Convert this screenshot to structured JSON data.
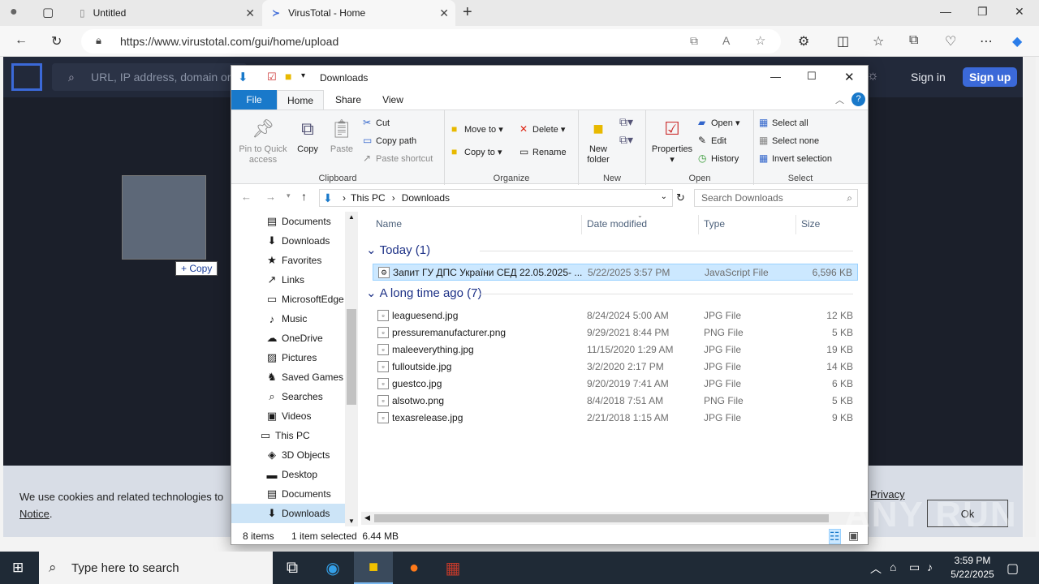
{
  "browser": {
    "tabs": [
      {
        "title": "Untitled",
        "active": false
      },
      {
        "title": "VirusTotal - Home",
        "active": true
      }
    ],
    "url": "https://www.virustotal.com/gui/home/upload"
  },
  "virustotal": {
    "search_placeholder": "URL, IP address, domain or fi",
    "signin": "Sign in",
    "signup": "Sign up",
    "drag_tooltip": "+ Copy",
    "cookie_text_1": "We use cookies and related technologies to",
    "cookie_text_2": "Notice",
    "privacy_link": "Privacy",
    "ok_button": "Ok"
  },
  "explorer": {
    "title": "Downloads",
    "ribbon_tabs": [
      "File",
      "Home",
      "Share",
      "View"
    ],
    "clipboard": {
      "label": "Clipboard",
      "pin": "Pin to Quick access",
      "copy": "Copy",
      "paste": "Paste",
      "cut": "Cut",
      "copy_path": "Copy path",
      "paste_shortcut": "Paste shortcut"
    },
    "organize": {
      "label": "Organize",
      "move_to": "Move to",
      "copy_to": "Copy to",
      "delete": "Delete",
      "rename": "Rename"
    },
    "new": {
      "label": "New",
      "new_folder": "New folder"
    },
    "open": {
      "label": "Open",
      "properties": "Properties",
      "open": "Open",
      "edit": "Edit",
      "history": "History"
    },
    "select": {
      "label": "Select",
      "select_all": "Select all",
      "select_none": "Select none",
      "invert": "Invert selection"
    },
    "breadcrumb": [
      "This PC",
      "Downloads"
    ],
    "search_placeholder": "Search Downloads",
    "nav_items": [
      {
        "label": "Documents",
        "icon": "documents-icon",
        "glyph": "▤"
      },
      {
        "label": "Downloads",
        "icon": "downloads-icon",
        "glyph": "⬇"
      },
      {
        "label": "Favorites",
        "icon": "favorites-icon",
        "glyph": "★"
      },
      {
        "label": "Links",
        "icon": "links-icon",
        "glyph": "↗"
      },
      {
        "label": "MicrosoftEdge",
        "icon": "folder-icon",
        "glyph": "▭"
      },
      {
        "label": "Music",
        "icon": "music-icon",
        "glyph": "♪"
      },
      {
        "label": "OneDrive",
        "icon": "onedrive-icon",
        "glyph": "☁"
      },
      {
        "label": "Pictures",
        "icon": "pictures-icon",
        "glyph": "▨"
      },
      {
        "label": "Saved Games",
        "icon": "saved-games-icon",
        "glyph": "♞"
      },
      {
        "label": "Searches",
        "icon": "searches-icon",
        "glyph": "⌕"
      },
      {
        "label": "Videos",
        "icon": "videos-icon",
        "glyph": "▣"
      },
      {
        "label": "This PC",
        "icon": "this-pc-icon",
        "glyph": "▭"
      },
      {
        "label": "3D Objects",
        "icon": "3d-objects-icon",
        "glyph": "◈"
      },
      {
        "label": "Desktop",
        "icon": "desktop-icon",
        "glyph": "▬"
      },
      {
        "label": "Documents",
        "icon": "documents-icon",
        "glyph": "▤"
      },
      {
        "label": "Downloads",
        "icon": "downloads-icon",
        "glyph": "⬇"
      }
    ],
    "columns": [
      "Name",
      "Date modified",
      "Type",
      "Size"
    ],
    "groups": [
      {
        "header": "Today (1)",
        "files": [
          {
            "name": "Запит ГУ ДПС України СЕД 22.05.2025- ...",
            "date": "5/22/2025 3:57 PM",
            "type": "JavaScript File",
            "size": "6,596 KB",
            "selected": true
          }
        ]
      },
      {
        "header": "A long time ago (7)",
        "files": [
          {
            "name": "leaguesend.jpg",
            "date": "8/24/2024 5:00 AM",
            "type": "JPG File",
            "size": "12 KB"
          },
          {
            "name": "pressuremanufacturer.png",
            "date": "9/29/2021 8:44 PM",
            "type": "PNG File",
            "size": "5 KB"
          },
          {
            "name": "maleeverything.jpg",
            "date": "11/15/2020 1:29 AM",
            "type": "JPG File",
            "size": "19 KB"
          },
          {
            "name": "fulloutside.jpg",
            "date": "3/2/2020 2:17 PM",
            "type": "JPG File",
            "size": "14 KB"
          },
          {
            "name": "guestco.jpg",
            "date": "9/20/2019 7:41 AM",
            "type": "JPG File",
            "size": "6 KB"
          },
          {
            "name": "alsotwo.png",
            "date": "8/4/2018 7:51 AM",
            "type": "PNG File",
            "size": "5 KB"
          },
          {
            "name": "texasrelease.jpg",
            "date": "2/21/2018 1:15 AM",
            "type": "JPG File",
            "size": "9 KB"
          }
        ]
      }
    ],
    "status_items": "8 items",
    "status_selected": "1 item selected  6.44 MB"
  },
  "taskbar": {
    "search_placeholder": "Type here to search",
    "time": "3:59 PM",
    "date": "5/22/2025"
  },
  "watermark": "ANY RUN"
}
